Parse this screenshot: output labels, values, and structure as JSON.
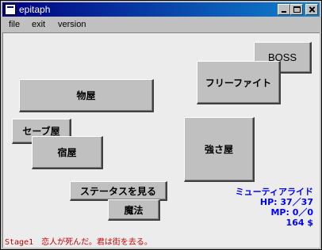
{
  "window": {
    "title": "epitaph"
  },
  "menu": {
    "file": "file",
    "exit": "exit",
    "version": "version"
  },
  "buttons": {
    "boss": "BOSS",
    "free_fight": "フリーファイト",
    "item_shop": "物屋",
    "save_shop": "セーブ屋",
    "inn": "宿屋",
    "strength_shop": "強さ屋",
    "view_status": "ステータスを見る",
    "magic": "魔法"
  },
  "status": {
    "name": "ミューティアライド",
    "hp": "HP: 37／37",
    "mp": "MP: 0／0",
    "money": "164 $"
  },
  "message": {
    "stage": "Stage1",
    "text": "恋人が死んだ。君は街を去る。"
  },
  "colors": {
    "status_text": "#0000ff",
    "message_text": "#cc0000",
    "titlebar": "#000080"
  }
}
